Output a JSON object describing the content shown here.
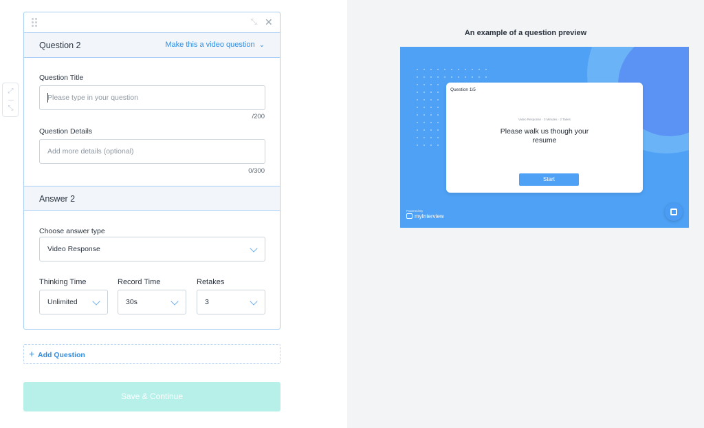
{
  "question": {
    "header": "Question 2",
    "video_link": "Make this a video question",
    "title_label": "Question Title",
    "title_placeholder": "Please type in your question",
    "title_counter": "/200",
    "details_label": "Question Details",
    "details_placeholder": "Add more details (optional)",
    "details_counter": "0/300"
  },
  "answer": {
    "header": "Answer 2",
    "type_label": "Choose answer type",
    "type_value": "Video Response",
    "thinking_label": "Thinking Time",
    "thinking_value": "Unlimited",
    "record_label": "Record Time",
    "record_value": "30s",
    "retakes_label": "Retakes",
    "retakes_value": "3"
  },
  "actions": {
    "add_question": "Add Question",
    "save": "Save & Continue"
  },
  "preview": {
    "title": "An example of a question preview",
    "question_num": "Question 1\\5",
    "meta": "Video Response  ·  3 Minutes  ·  2 Takes",
    "question_text": "Please walk us though your resume",
    "start": "Start",
    "powered_by": "Powered By",
    "brand": "myInterview"
  },
  "colors": {
    "accent": "#2f8ce0",
    "border": "#a8cdf5",
    "save_button": "#b6f0e9",
    "preview_bg": "#4ea1f5"
  }
}
